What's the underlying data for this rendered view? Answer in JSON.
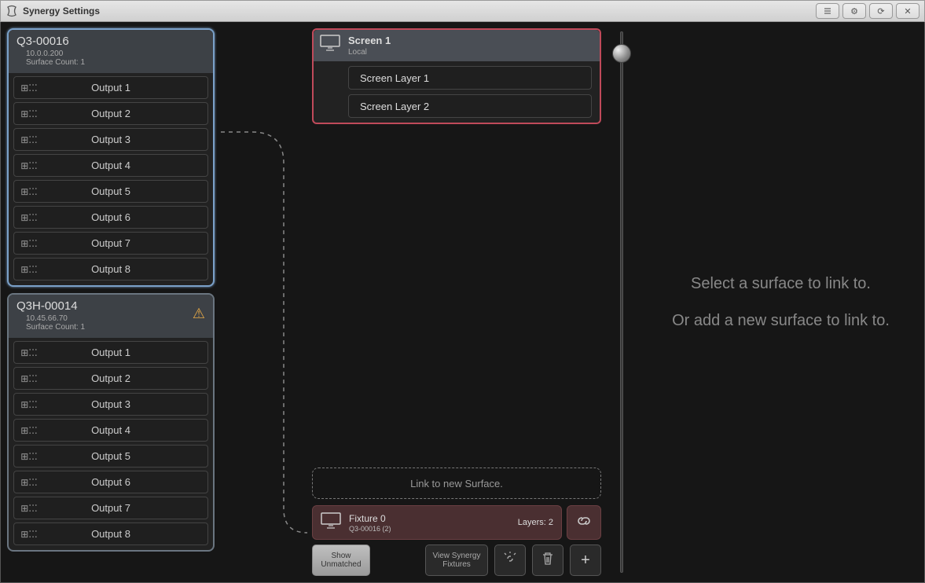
{
  "titlebar": {
    "title": "Synergy Settings"
  },
  "devices": [
    {
      "name": "Q3-00016",
      "ip": "10.0.0.200",
      "surface_count": "Surface Count: 1",
      "warning": false,
      "selected": true,
      "outputs": [
        "Output 1",
        "Output 2",
        "Output 3",
        "Output 4",
        "Output 5",
        "Output 6",
        "Output 7",
        "Output 8"
      ]
    },
    {
      "name": "Q3H-00014",
      "ip": "10.45.66.70",
      "surface_count": "Surface Count: 1",
      "warning": true,
      "selected": false,
      "outputs": [
        "Output 1",
        "Output 2",
        "Output 3",
        "Output 4",
        "Output 5",
        "Output 6",
        "Output 7",
        "Output 8"
      ]
    }
  ],
  "screen": {
    "name": "Screen 1",
    "subtitle": "Local",
    "layers": [
      "Screen Layer 1",
      "Screen Layer 2"
    ]
  },
  "link_drop": "Link to new Surface.",
  "fixture": {
    "name": "Fixture 0",
    "subtitle": "Q3-00016 (2)",
    "layers_label": "Layers: 2"
  },
  "buttons": {
    "show_unmatched_l1": "Show",
    "show_unmatched_l2": "Unmatched",
    "view_synergy_l1": "View Synergy",
    "view_synergy_l2": "Fixtures"
  },
  "right": {
    "msg1": "Select a surface to link to.",
    "msg2": "Or add a new surface to link to."
  }
}
